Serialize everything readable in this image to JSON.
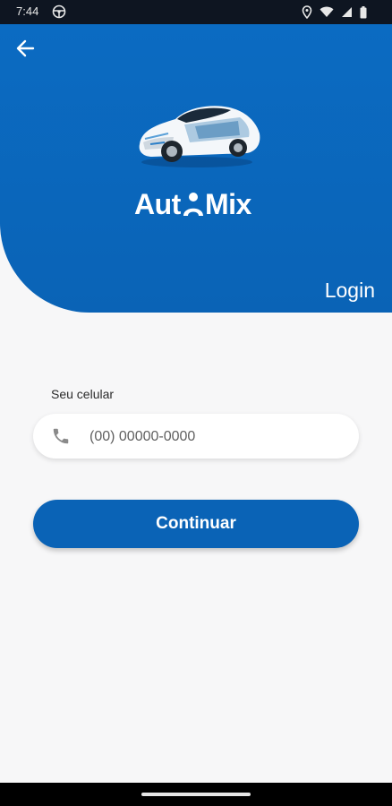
{
  "status_bar": {
    "time": "7:44"
  },
  "header": {
    "brand": "AutoMix",
    "brand_left": "Aut",
    "brand_right": "Mix",
    "title": "Login"
  },
  "form": {
    "phone_label": "Seu celular",
    "phone_placeholder": "(00) 00000-0000",
    "phone_value": ""
  },
  "actions": {
    "continue_label": "Continuar"
  },
  "icons": {
    "back": "arrow-left-icon",
    "phone": "phone-icon",
    "status_left": "steering-wheel-icon",
    "location": "location-icon",
    "wifi": "wifi-icon",
    "signal": "signal-icon",
    "battery": "battery-icon"
  },
  "colors": {
    "primary": "#0A63B6",
    "background": "#F7F7F8",
    "statusbar": "#0E1521"
  }
}
